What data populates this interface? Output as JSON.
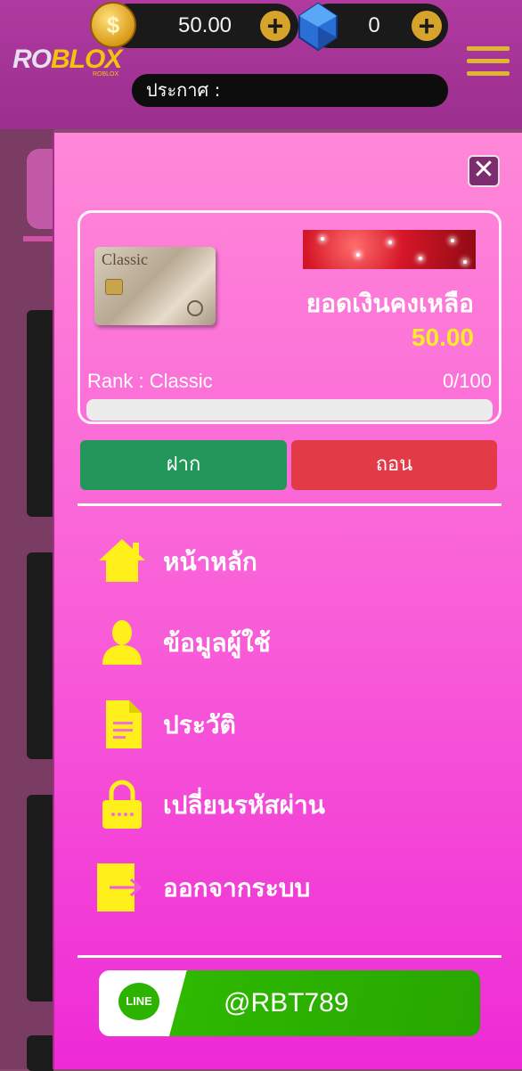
{
  "header": {
    "coin_symbol": "$",
    "coin_balance": "50.00",
    "gem_balance": "0",
    "add_symbol": "+",
    "logo_prefix": "RO",
    "logo_suffix": "BLOX",
    "logo_tagline": "ROBLOX",
    "announcement_label": "ประกาศ :"
  },
  "drawer": {
    "close_symbol": "✕",
    "card": {
      "card_label": "Classic",
      "balance_label": "ยอดเงินคงเหลือ",
      "balance_value": "50.00",
      "rank_label": "Rank : Classic",
      "rank_progress_text": "0/100",
      "rank_progress_fraction": 0
    },
    "buttons": {
      "deposit": "ฝาก",
      "withdraw": "ถอน"
    },
    "menu": [
      {
        "label": "หน้าหลัก",
        "icon": "home-icon"
      },
      {
        "label": "ข้อมูลผู้ใช้",
        "icon": "user-icon"
      },
      {
        "label": "ประวัติ",
        "icon": "document-icon"
      },
      {
        "label": "เปลี่ยนรหัสผ่าน",
        "icon": "lock-icon"
      },
      {
        "label": "ออกจากระบบ",
        "icon": "logout-icon"
      }
    ],
    "line": {
      "logo_text": "LINE",
      "line_id": "@RBT789"
    }
  },
  "colors": {
    "accent_yellow": "#ffea2a",
    "deposit_green": "#23975a",
    "withdraw_red": "#e33a48",
    "drawer_pink": "#f85bd8",
    "line_green": "#2eb800"
  }
}
